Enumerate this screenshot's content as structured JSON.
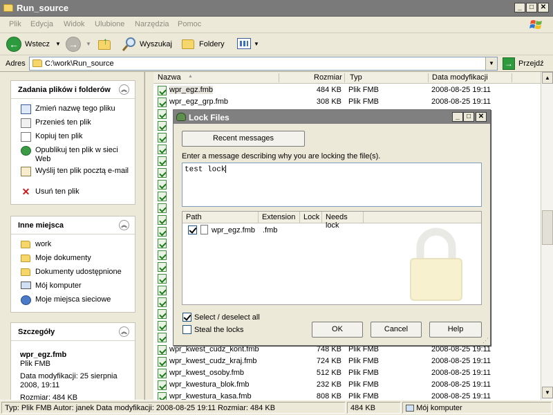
{
  "window": {
    "title": "Run_source"
  },
  "menu": [
    "Plik",
    "Edycja",
    "Widok",
    "Ulubione",
    "Narzędzia",
    "Pomoc"
  ],
  "toolbar": {
    "back": "Wstecz",
    "search": "Wyszukaj",
    "folders": "Foldery"
  },
  "address": {
    "label": "Adres",
    "path": "C:\\work\\Run_source",
    "go": "Przejdź"
  },
  "tasks_panel": {
    "title": "Zadania plików i folderów",
    "items": [
      "Zmień nazwę tego pliku",
      "Przenieś ten plik",
      "Kopiuj ten plik",
      "Opublikuj ten plik w sieci Web",
      "Wyślij ten plik pocztą e-mail",
      "Usuń ten plik"
    ]
  },
  "places_panel": {
    "title": "Inne miejsca",
    "items": [
      "work",
      "Moje dokumenty",
      "Dokumenty udostępnione",
      "Mój komputer",
      "Moje miejsca sieciowe"
    ]
  },
  "details_panel": {
    "title": "Szczegóły",
    "name": "wpr_egz.fmb",
    "type": "Plik FMB",
    "modified": "Data modyfikacji: 25 sierpnia 2008, 19:11",
    "size": "Rozmiar: 484 KB"
  },
  "columns": {
    "name": "Nazwa",
    "size": "Rozmiar",
    "type": "Typ",
    "date": "Data modyfikacji"
  },
  "files_top": [
    {
      "name": "wpr_egz.fmb",
      "size": "484 KB",
      "type": "Plik FMB",
      "date": "2008-08-25 19:11"
    },
    {
      "name": "wpr_egz_grp.fmb",
      "size": "308 KB",
      "type": "Plik FMB",
      "date": "2008-08-25 19:11"
    }
  ],
  "files_bottom": [
    {
      "name": "wpr_kwest_cudz_kont.fmb",
      "size": "748 KB",
      "type": "Plik FMB",
      "date": "2008-08-25 19:11"
    },
    {
      "name": "wpr_kwest_cudz_kraj.fmb",
      "size": "724 KB",
      "type": "Plik FMB",
      "date": "2008-08-25 19:11"
    },
    {
      "name": "wpr_kwest_osoby.fmb",
      "size": "512 KB",
      "type": "Plik FMB",
      "date": "2008-08-25 19:11"
    },
    {
      "name": "wpr_kwestura_blok.fmb",
      "size": "232 KB",
      "type": "Plik FMB",
      "date": "2008-08-25 19:11"
    },
    {
      "name": "wpr_kwestura_kasa.fmb",
      "size": "808 KB",
      "type": "Plik FMB",
      "date": "2008-08-25 19:11"
    }
  ],
  "statusbar": {
    "info": "Typ: Plik FMB Autor: janek Data modyfikacji: 2008-08-25 19:11 Rozmiar: 484 KB",
    "size": "484 KB",
    "location": "Mój komputer"
  },
  "dialog": {
    "title": "Lock Files",
    "recent_button": "Recent messages",
    "prompt": "Enter a message describing why you are locking the file(s).",
    "message": "test lock",
    "grid_columns": {
      "path": "Path",
      "extension": "Extension",
      "lock": "Lock",
      "needs_lock": "Needs lock"
    },
    "grid_rows": [
      {
        "path": "wpr_egz.fmb",
        "extension": ".fmb",
        "checked": true
      }
    ],
    "select_all": "Select / deselect all",
    "select_all_checked": true,
    "steal": "Steal the locks",
    "steal_checked": false,
    "ok": "OK",
    "cancel": "Cancel",
    "help": "Help"
  }
}
